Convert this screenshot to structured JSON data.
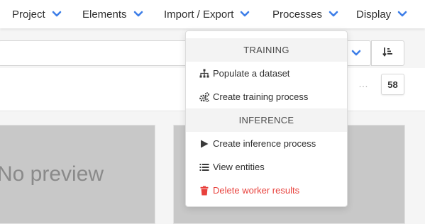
{
  "navbar": {
    "items": [
      {
        "label": "Project"
      },
      {
        "label": "Elements"
      },
      {
        "label": "Import / Export"
      },
      {
        "label": "Processes"
      },
      {
        "label": "Display"
      }
    ]
  },
  "toolbar": {
    "page_count": "58",
    "ellipsis": "…"
  },
  "cards": {
    "placeholder_text": "No preview"
  },
  "processes_menu": {
    "training_header": "TRAINING",
    "populate_dataset": "Populate a dataset",
    "create_training_process": "Create training process",
    "inference_header": "INFERENCE",
    "create_inference_process": "Create inference process",
    "view_entities": "View entities",
    "delete_worker_results": "Delete worker results"
  },
  "colors": {
    "accent": "#3d7ee8",
    "danger": "#e8413c",
    "icon": "#3a3a3a"
  },
  "icons": {
    "nav_chevron": "chevron-down-icon",
    "populate": "sitemap-icon",
    "training": "cogs-icon",
    "inference": "play-icon",
    "entities": "list-icon",
    "delete": "trash-icon",
    "sort": "sort-amount-icon"
  }
}
